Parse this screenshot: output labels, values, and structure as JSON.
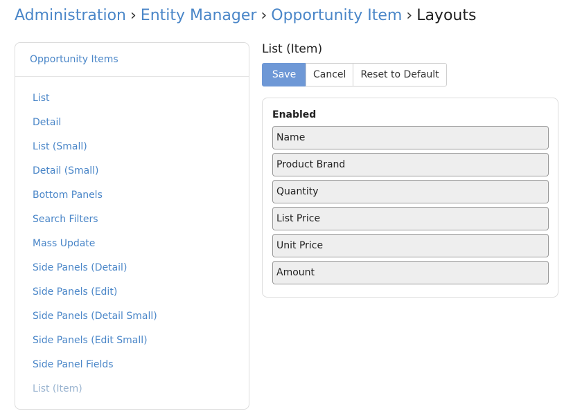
{
  "breadcrumb": {
    "items": [
      "Administration",
      "Entity Manager",
      "Opportunity Item"
    ],
    "separator": "›",
    "current": "Layouts"
  },
  "sidebar": {
    "heading": "Opportunity Items",
    "items": [
      {
        "label": "List"
      },
      {
        "label": "Detail"
      },
      {
        "label": "List (Small)"
      },
      {
        "label": "Detail (Small)"
      },
      {
        "label": "Bottom Panels"
      },
      {
        "label": "Search Filters"
      },
      {
        "label": "Mass Update"
      },
      {
        "label": "Side Panels (Detail)"
      },
      {
        "label": "Side Panels (Edit)"
      },
      {
        "label": "Side Panels (Detail Small)"
      },
      {
        "label": "Side Panels (Edit Small)"
      },
      {
        "label": "Side Panel Fields"
      },
      {
        "label": "List (Item)"
      }
    ]
  },
  "layout": {
    "title": "List (Item)",
    "buttons": {
      "save": "Save",
      "cancel": "Cancel",
      "reset": "Reset to Default"
    },
    "group_title": "Enabled",
    "fields": [
      "Name",
      "Product Brand",
      "Quantity",
      "List Price",
      "Unit Price",
      "Amount"
    ]
  },
  "colors": {
    "link": "#4a86c8",
    "primary": "#6e98d6",
    "active_item": "#9ab4d0"
  }
}
